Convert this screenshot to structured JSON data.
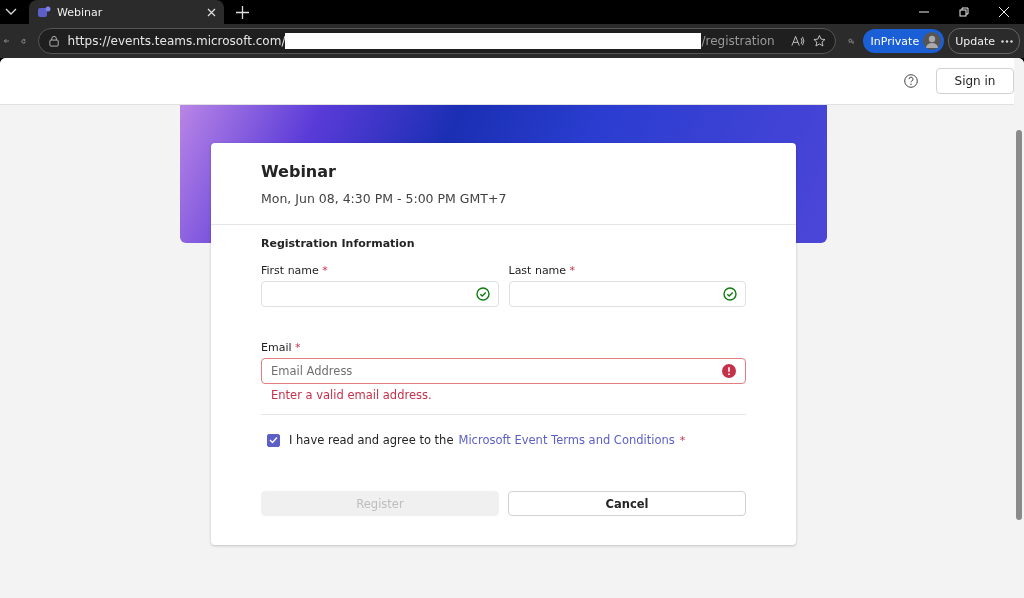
{
  "browser": {
    "tab": {
      "title": "Webinar",
      "selected": true
    },
    "url_start": "https://events.teams.microsoft.com/",
    "url_end": "/registration",
    "profile_label": "InPrivate",
    "update_label": "Update"
  },
  "header": {
    "sign_in": "Sign in"
  },
  "event": {
    "title": "Webinar",
    "time": "Mon, Jun 08, 4:30 PM - 5:00 PM GMT+7"
  },
  "form": {
    "section_title": "Registration Information",
    "name_fields": [
      {
        "label": "First name",
        "required_mark": "*",
        "valid": true
      },
      {
        "label": "Last name",
        "required_mark": "*",
        "valid": true
      }
    ],
    "email": {
      "label": "Email",
      "required_mark": "*",
      "placeholder": "Email Address",
      "invalid": true,
      "error": "Enter a valid email address."
    },
    "agreement": {
      "checked": true,
      "text": "I have read and agree to the",
      "link": "Microsoft Event Terms and Conditions",
      "required_mark": "*"
    },
    "buttons": [
      {
        "label": "Register",
        "disabled": true
      },
      {
        "label": "Cancel",
        "disabled": false
      }
    ]
  }
}
